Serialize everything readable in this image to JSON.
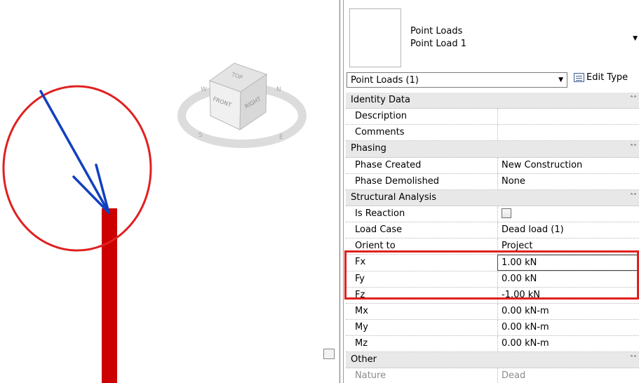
{
  "view_cube": {
    "faces": [
      "TOP",
      "FRONT",
      "RIGHT"
    ],
    "compass": [
      "N",
      "E",
      "S",
      "W"
    ]
  },
  "properties": {
    "family_name": "Point Loads",
    "type_name": "Point Load 1",
    "selector_label": "Point Loads (1)",
    "edit_type_label": "Edit Type",
    "groups": [
      {
        "label": "Identity Data",
        "rows": [
          {
            "name": "Description",
            "value": ""
          },
          {
            "name": "Comments",
            "value": ""
          }
        ]
      },
      {
        "label": "Phasing",
        "rows": [
          {
            "name": "Phase Created",
            "value": "New Construction"
          },
          {
            "name": "Phase Demolished",
            "value": "None"
          }
        ]
      },
      {
        "label": "Structural Analysis",
        "rows": [
          {
            "name": "Is Reaction",
            "value": "",
            "checkbox": true
          },
          {
            "name": "Load Case",
            "value": "Dead load (1)"
          },
          {
            "name": "Orient to",
            "value": "Project"
          },
          {
            "name": "Fx",
            "value": "1.00 kN"
          },
          {
            "name": "Fy",
            "value": "0.00 kN"
          },
          {
            "name": "Fz",
            "value": "-1.00 kN"
          },
          {
            "name": "Mx",
            "value": "0.00 kN-m"
          },
          {
            "name": "My",
            "value": "0.00 kN-m"
          },
          {
            "name": "Mz",
            "value": "0.00 kN-m"
          }
        ]
      },
      {
        "label": "Other",
        "rows": [
          {
            "name": "Nature",
            "value": "Dead",
            "readonly": true
          }
        ]
      }
    ]
  },
  "colors": {
    "load_arrow": "#1040c0",
    "column": "#cc0000",
    "annotation": "#e02020"
  }
}
